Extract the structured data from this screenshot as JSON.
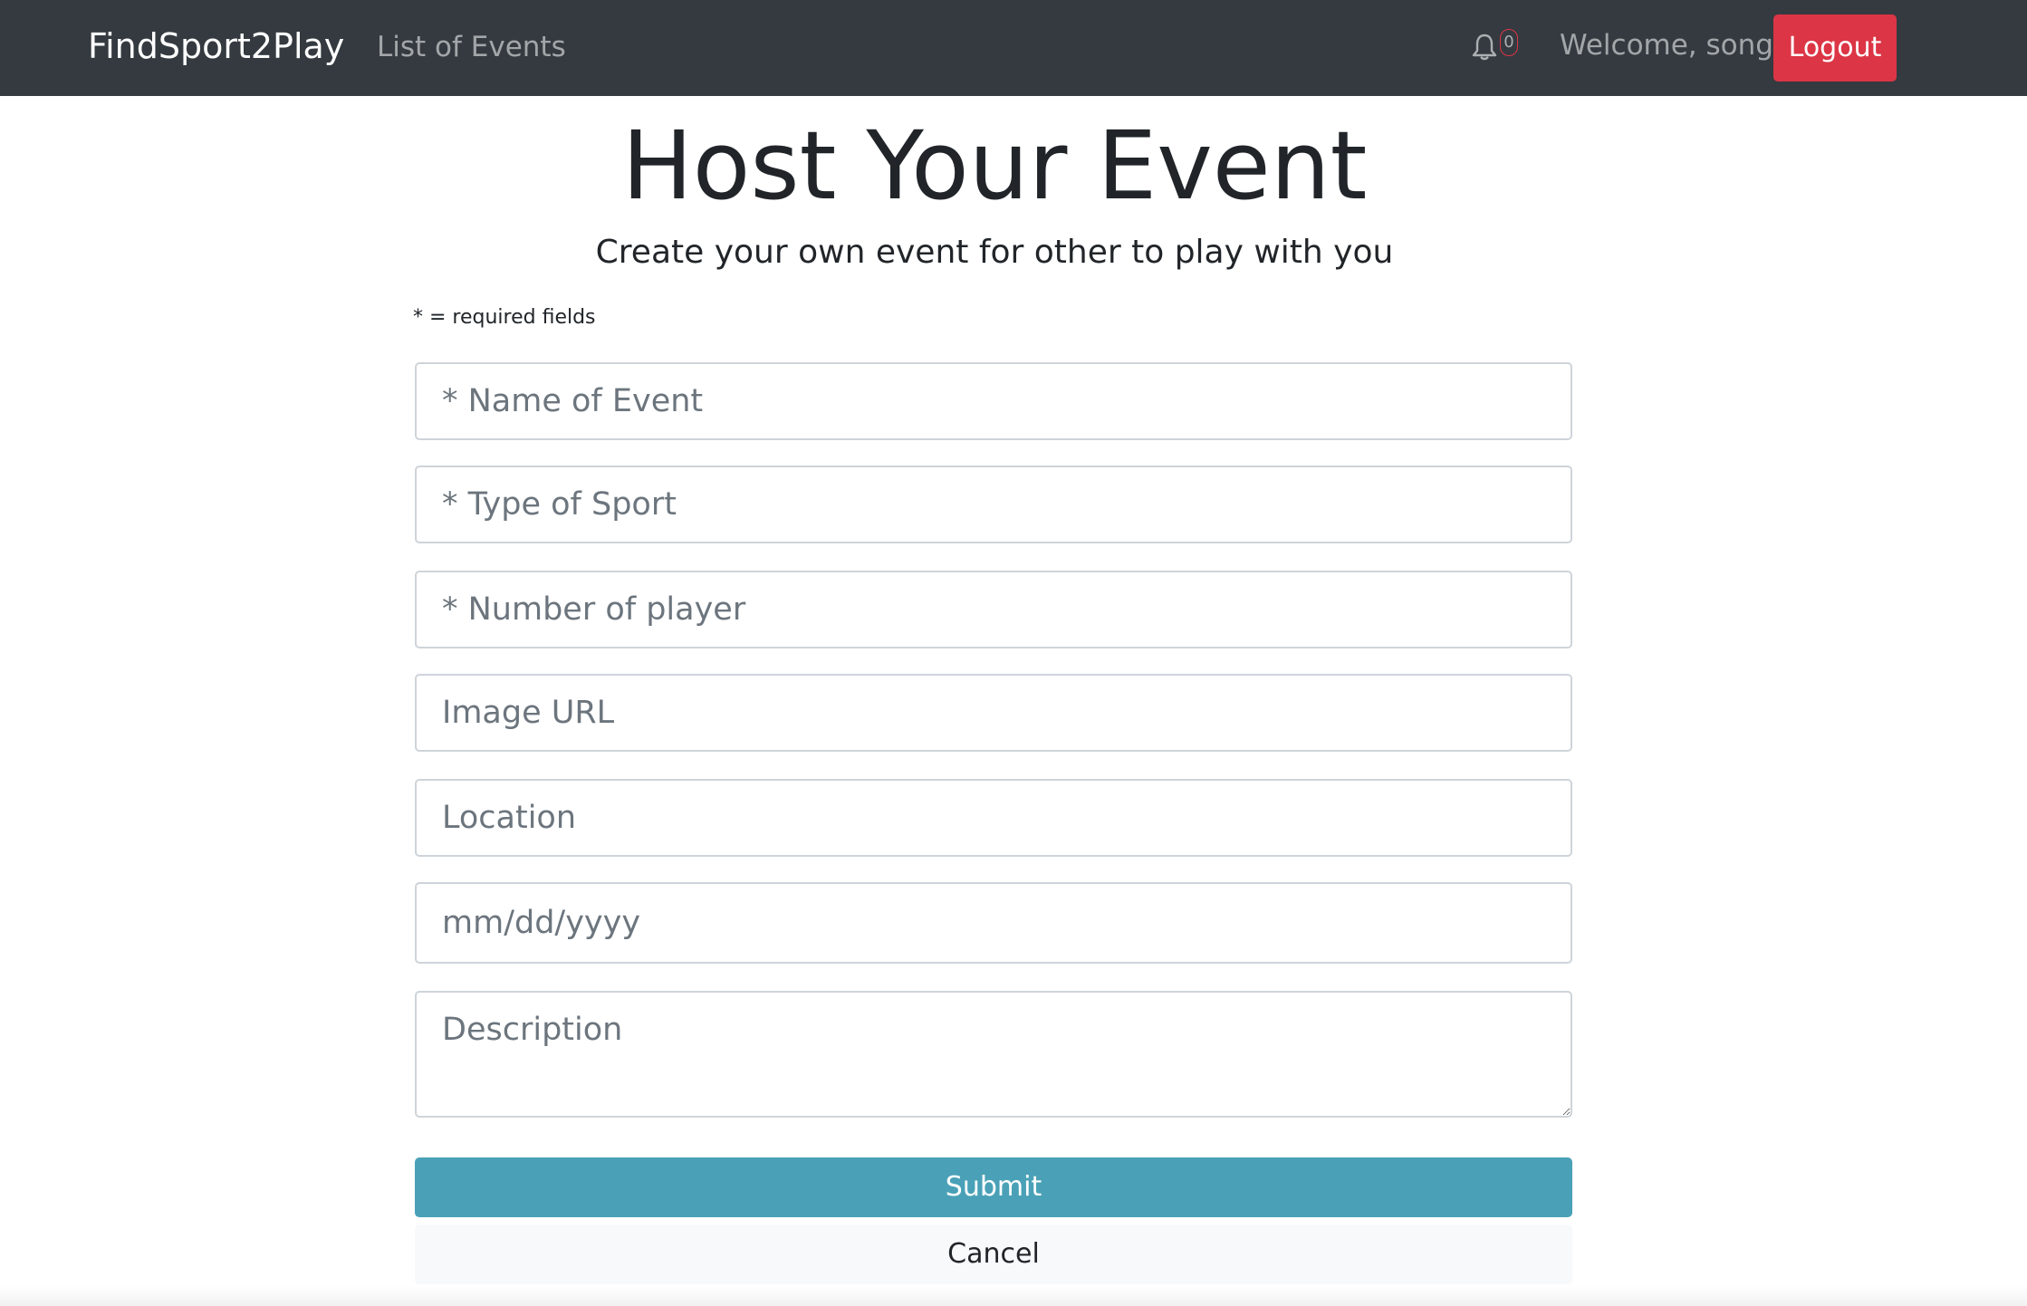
{
  "navbar": {
    "brand": "FindSport2Play",
    "links": [
      {
        "label": "List of Events"
      }
    ],
    "notifications": {
      "icon": "bell-icon",
      "count": "0",
      "badge_color": "#dc3545"
    },
    "welcome_text": "Welcome, song",
    "logout_label": "Logout",
    "background": "#343a40"
  },
  "main": {
    "title": "Host Your Event",
    "subtitle": "Create your own event for other to play with you",
    "required_note": "* = required fields"
  },
  "form": {
    "name": {
      "placeholder": "* Name of Event",
      "value": ""
    },
    "sport": {
      "placeholder": "* Type of Sport",
      "value": ""
    },
    "players": {
      "placeholder": "* Number of player",
      "value": ""
    },
    "image_url": {
      "placeholder": "Image URL",
      "value": ""
    },
    "location": {
      "placeholder": "Location",
      "value": ""
    },
    "date": {
      "placeholder": "mm/dd/yyyy",
      "value": ""
    },
    "description": {
      "placeholder": "Description",
      "value": ""
    },
    "submit_label": "Submit",
    "cancel_label": "Cancel"
  },
  "colors": {
    "submit": "#4aa1b7",
    "logout": "#dc3545",
    "cancel": "#f8f9fa"
  }
}
